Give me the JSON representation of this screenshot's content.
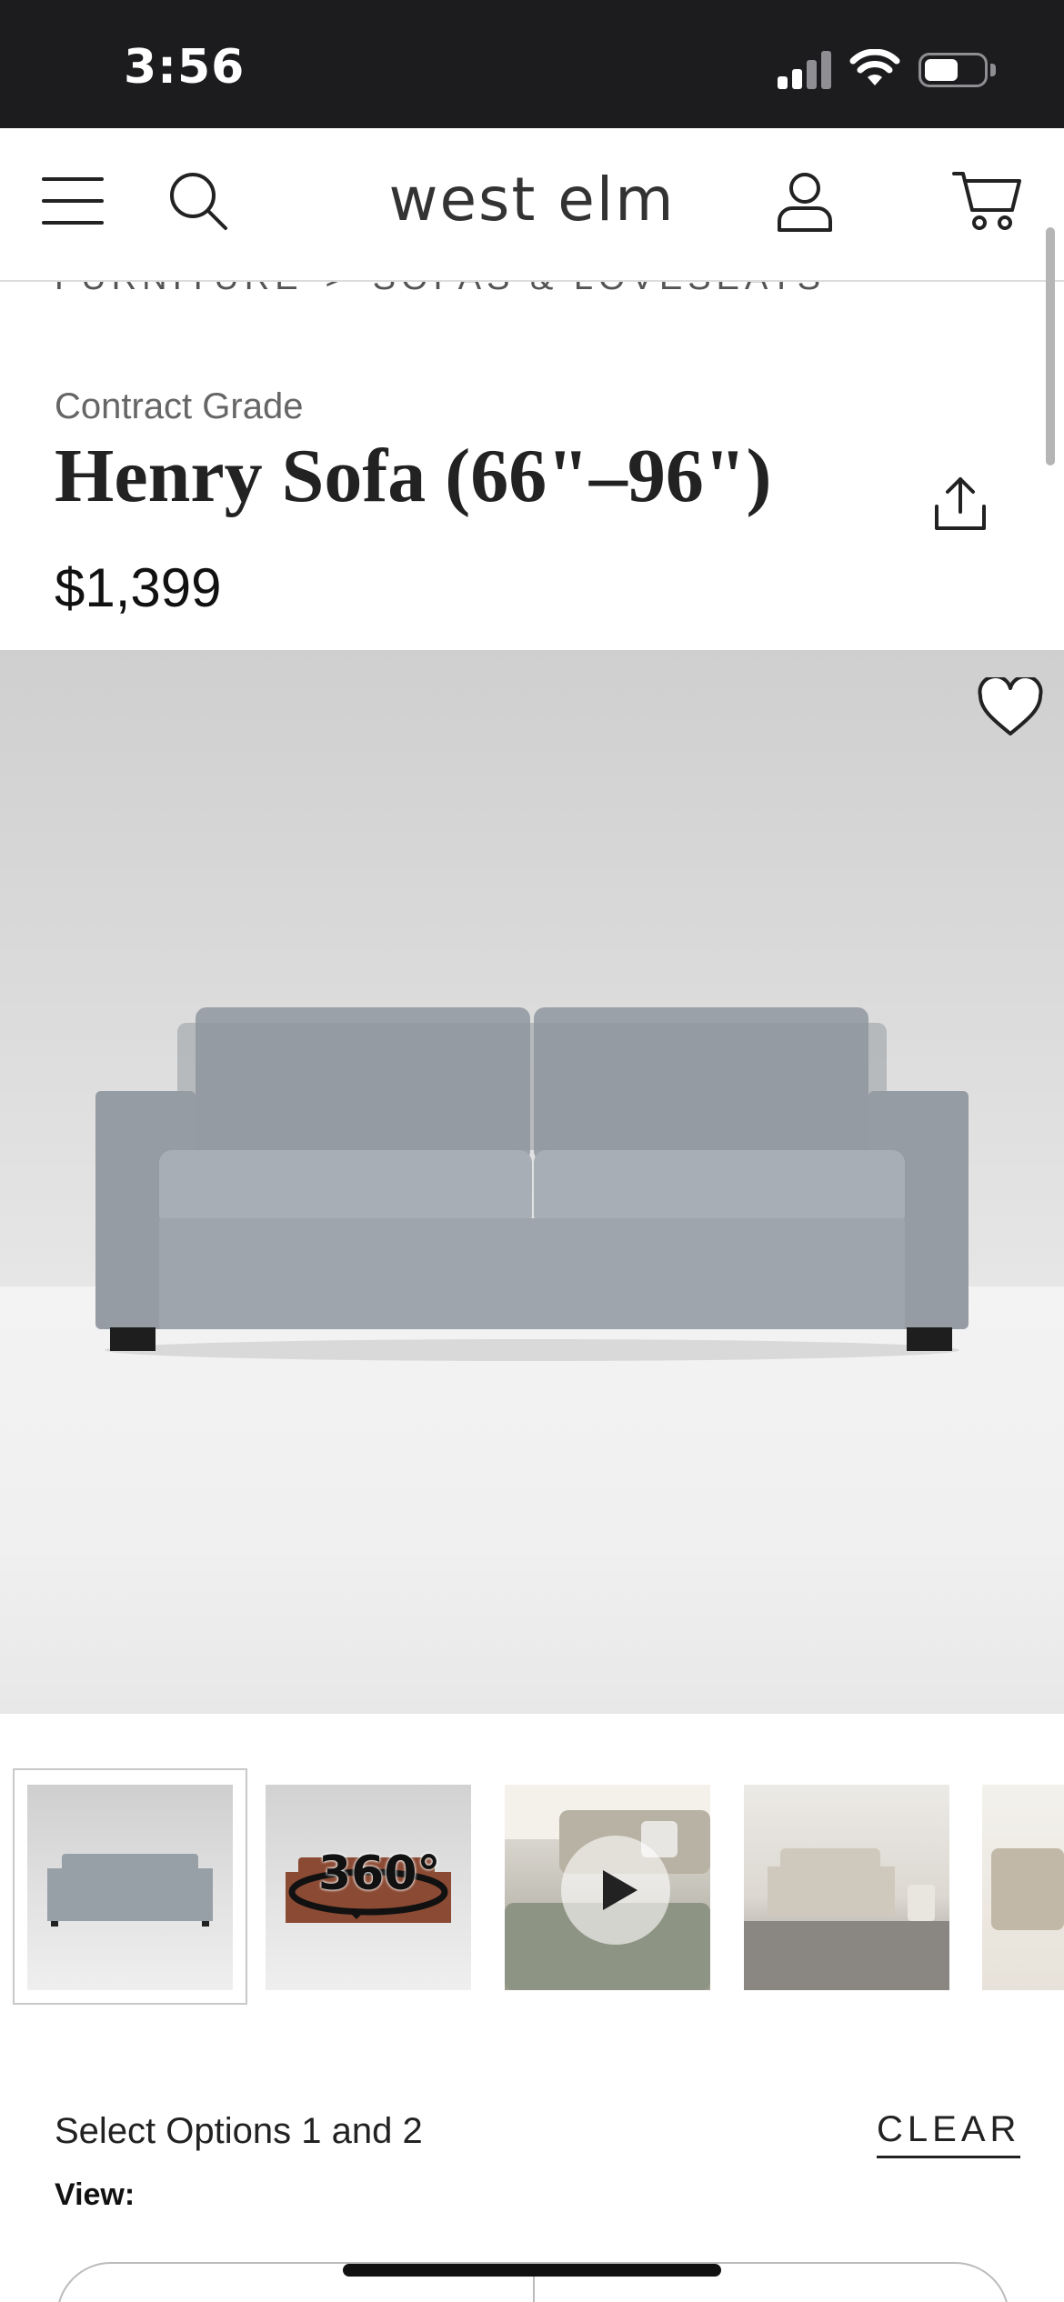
{
  "status_bar": {
    "time": "3:56"
  },
  "header": {
    "logo": "west elm",
    "icons": [
      "menu-icon",
      "search-icon",
      "account-icon",
      "cart-icon"
    ]
  },
  "breadcrumb": {
    "items": [
      "FURNITURE",
      "SOFAS & LOVESEATS"
    ],
    "separator": ">"
  },
  "product": {
    "eyebrow": "Contract Grade",
    "title": "Henry Sofa (66\"–96\")",
    "price": "$1,399"
  },
  "gallery": {
    "badge_360": "360°",
    "thumbnails": [
      "front-view",
      "360-view",
      "video",
      "room-view",
      "side-view"
    ]
  },
  "options": {
    "title": "Select Options 1 and 2",
    "clear_label": "CLEAR",
    "view_label": "View:"
  },
  "colors": {
    "status_bar_bg": "#1c1c1e",
    "sofa": "#9fa6ad",
    "text": "#222222"
  }
}
